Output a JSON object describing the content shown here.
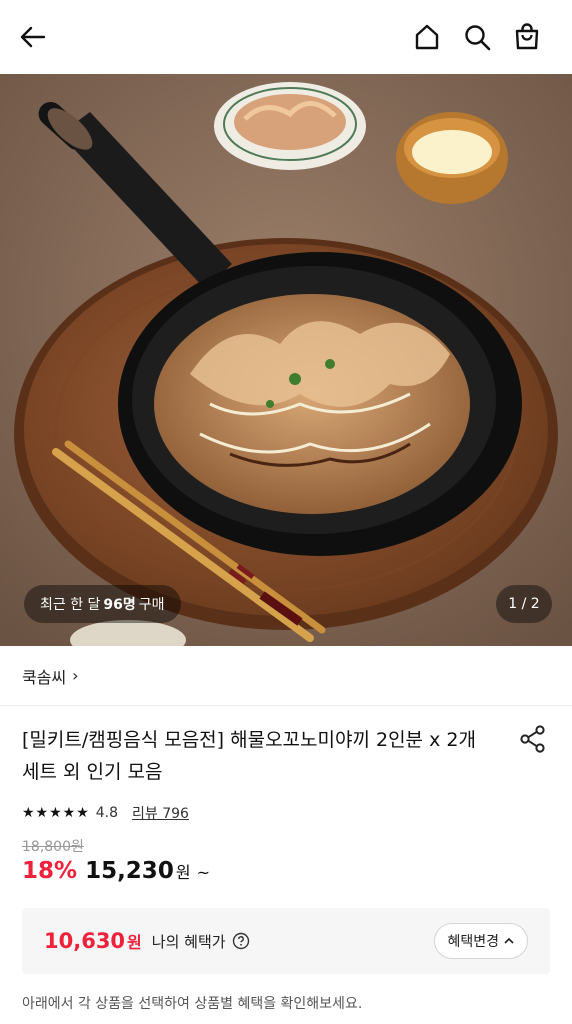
{
  "header": {
    "back_icon": "arrow-left-icon",
    "home_icon": "home-icon",
    "search_icon": "search-icon",
    "cart_icon": "shopping-bag-icon"
  },
  "gallery": {
    "recent_prefix": "최근 한 달",
    "recent_count": "96명",
    "recent_suffix": "구매",
    "page_indicator": "1 / 2"
  },
  "brand": {
    "name": "쿡솜씨",
    "chevron": "›"
  },
  "product": {
    "title": "[밀키트/캠핑음식 모음전] 해물오꼬노미야끼 2인분 x 2개 세트 외 인기 모음",
    "stars": "★★★★★",
    "rating": "4.8",
    "review_label": "리뷰 796",
    "original_price": "18,800원",
    "discount": "18%",
    "sale_price": "15,230",
    "currency": "원",
    "tilde": "~"
  },
  "benefit": {
    "price": "10,630",
    "currency": "원",
    "label": "나의 혜택가",
    "change_label": "혜택변경"
  },
  "notice": "아래에서 각 상품을 선택하여 상품별 혜택을 확인해보세요.",
  "colors": {
    "accent_red": "#f0213a",
    "benefit_bg": "#f6f6f6"
  }
}
